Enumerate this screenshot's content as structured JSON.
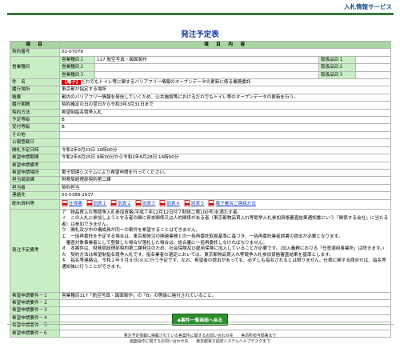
{
  "header": {
    "service_title": "入札情報サービス",
    "page_title": "発注予定表"
  },
  "table": {
    "head_item": "項　目",
    "head_content": "項　目　内　容",
    "rows": {
      "contract_no": {
        "label": "契約番号",
        "value": "02-07078"
      },
      "biz_type": {
        "label": "営業種目"
      },
      "biz1": {
        "sub": "営業種目１",
        "value": "117 航空写真・図面製作",
        "rank_label": "取扱品目１",
        "rank_value": ""
      },
      "biz2": {
        "sub": "営業種目２",
        "value": "",
        "rank_label": "取扱品目２",
        "rank_value": ""
      },
      "biz3": {
        "sub": "営業種目３",
        "value": "",
        "rank_label": "取扱品目３",
        "rank_value": ""
      },
      "subject": {
        "label": "件　名",
        "tag": "【電子】",
        "value": "だれでもトイレ等に関するバリアフリー情報のオープンデータの更新に係る業務委託"
      },
      "place": {
        "label": "履行場所",
        "value": "東京都が指定する場所"
      },
      "summary": {
        "label": "概要",
        "value": "都内のバリアフリー情報を発信していくため、公共施設等におけるだれでもトイレ等のオープンデータの更新を行う。"
      },
      "period": {
        "label": "履行期間",
        "value": "契約確定の日の翌日から令和3年3月31日まで"
      },
      "method": {
        "label": "契約方法",
        "value": "希望制指名競争入札"
      },
      "grade": {
        "label": "予定等級",
        "value": "B"
      },
      "recv_grade": {
        "label": "受付等級",
        "value": "B"
      },
      "other": {
        "label": "その他",
        "value": ""
      },
      "pub_date": {
        "label": "公報登載日",
        "value": ""
      },
      "open_date": {
        "label": "開札予定日時",
        "value": "令和2年9月23日 10時00分"
      },
      "apply_period": {
        "label": "希望申請期間",
        "value": "令和2年8月25日 9時30分から令和2年8月28日 16時00分"
      },
      "apply_note": {
        "label": "希望申請備考",
        "value": ""
      },
      "apply_method": {
        "label": "希望申請場所",
        "value": "電子調達システムにより希望申請を行ってください。"
      },
      "dept": {
        "label": "担当局部課",
        "value": "財務局経理部契約第二課"
      },
      "person": {
        "label": "担当者",
        "value": "契約担当"
      },
      "phone": {
        "label": "連絡先",
        "value": "03-5388-2637"
      }
    },
    "docs": {
      "label": "配布資料等",
      "items": [
        {
          "name": "仕様書"
        },
        {
          "name": "別表１"
        },
        {
          "name": "別表２"
        },
        {
          "name": "別表３"
        },
        {
          "name": "別表４"
        },
        {
          "name": "別表５"
        },
        {
          "name": "電子署名ご連絡方法"
        }
      ]
    },
    "notes": {
      "label": "発注予定備考",
      "lines": [
        "ア　物品買入れ等競争入札参加資格(平成７年12月12日付７財経二第100号)を満たす者。",
        "イ　この入札に参加しようとする者の関に資本関係又は人的関係がある者（東京都物品買入れ等競争入札参加資格審査結果通知書にいう「関係する会社」に当たる者）は参加できません。",
        "ウ　開札及び中の構成員が同一の案件を希望することはできません。",
        "エ　一括再委託を予定する場合は、東京都発注の関連業務との一括再委託取扱基準に基づき、一括再委託業者調書の提出が必要となります。",
        "　審査対象事業者として登録した場合が落札した場合は、総合審に一括再委託しなければなりません。",
        "オ　本案件は、財務局経理部契約第二課発注のため、社会保険及び雇用保険に加入していることが必要です。(加入義務における「任意適用事業所」は除きます。)",
        "カ　契約方法は希望制指名競争入札です。指名業者の選定においては、東京都物品買入れ等競争入札参加資格審査結果を基準とします。",
        "キ　指名等連絡は、令和２年９月８日(火)に行う予定です。なお、希望者の提出があっても、必ずしも指名されるとは限りません。仕様に関する問合せは、指名等通知後に行うことができます。"
      ]
    },
    "requirement1": {
      "label": "希望申請要件－１",
      "value": "営業種目117「航空写真・図面製作」の「B」の等級に格付されていること。"
    },
    "requirements_empty": [
      {
        "label": "希望申請要件－２"
      },
      {
        "label": "希望申請要件－３"
      },
      {
        "label": "希望申請要件－４"
      },
      {
        "label": "希望申請要件－５"
      },
      {
        "label": "希望申請要件－６"
      }
    ]
  },
  "back_button": "◆案件一覧画面へ戻る",
  "footer": {
    "line1": "発注予定情報に掲載されている各案件に関するお問い合わせ先　　各局所担当部署まで",
    "line2": "画面操作に関するお問い合わせ先　　東京都電子調達システムヘルプデスクまで"
  },
  "colors": {
    "accent": "#1c3fa8",
    "label_bg": "#c9eec6",
    "header_bg": "#a9d4a3",
    "rule": "#3c7a3c",
    "button": "#2f8f2f"
  }
}
